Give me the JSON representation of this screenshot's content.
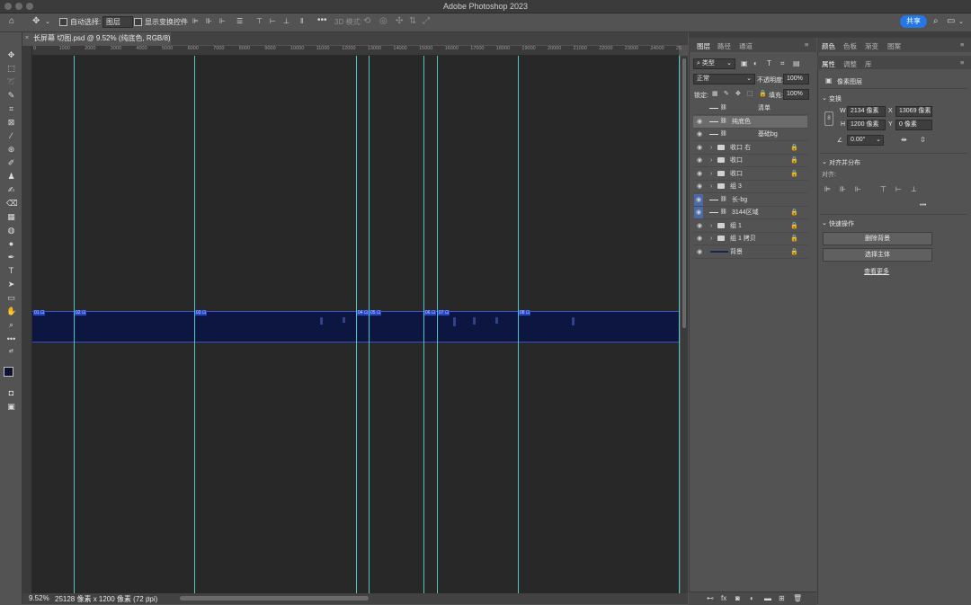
{
  "window": {
    "title": "Adobe Photoshop 2023"
  },
  "options_bar": {
    "auto_select_label": "自动选择:",
    "auto_select_value": "图层",
    "show_transform_label": "显示变换控件",
    "mode_3d_label": "3D 模式:",
    "share_label": "共享"
  },
  "document": {
    "tab_label": "长屏幕 切图.psd @ 9.52% (纯底色, RGB/8) *",
    "zoom": "9.52%",
    "info": "25128 像素 x 1200 像素 (72 ppi)"
  },
  "ruler": {
    "ticks": [
      "0",
      "1000",
      "2000",
      "3000",
      "4000",
      "5000",
      "6000",
      "7000",
      "8000",
      "9000",
      "10000",
      "11000",
      "12000",
      "13000",
      "14000",
      "15000",
      "16000",
      "17000",
      "18000",
      "19000",
      "20000",
      "21000",
      "22000",
      "23000",
      "24000",
      "25"
    ]
  },
  "slices": [
    "01",
    "02",
    "03",
    "04",
    "05",
    "06",
    "07",
    "08"
  ],
  "layers_panel": {
    "tabs": [
      "图层",
      "路径",
      "通道"
    ],
    "filter_label": "类型",
    "blend_mode": "正常",
    "opacity_label": "不透明度:",
    "opacity_value": "100%",
    "lock_label": "锁定:",
    "fill_label": "填充:",
    "fill_value": "100%",
    "layers": [
      {
        "name": "清单",
        "visible": false,
        "kind": "adjustment",
        "locked": false
      },
      {
        "name": "纯底色",
        "visible": true,
        "kind": "adjustment",
        "locked": false,
        "selected": true
      },
      {
        "name": "基础bg",
        "visible": true,
        "kind": "adjustment",
        "locked": false
      },
      {
        "name": "收口 右",
        "visible": true,
        "kind": "group",
        "locked": true
      },
      {
        "name": "收口",
        "visible": true,
        "kind": "group",
        "locked": true
      },
      {
        "name": "收口",
        "visible": true,
        "kind": "group",
        "locked": true
      },
      {
        "name": "组 3",
        "visible": true,
        "kind": "group",
        "locked": false
      },
      {
        "name": "长-bg",
        "visible": true,
        "kind": "adjustment",
        "locked": false
      },
      {
        "name": "3144区域",
        "visible": true,
        "kind": "adjustment",
        "locked": true
      },
      {
        "name": "组 1",
        "visible": true,
        "kind": "group",
        "locked": true
      },
      {
        "name": "组 1 拷贝",
        "visible": true,
        "kind": "group",
        "locked": true
      },
      {
        "name": "背景",
        "visible": true,
        "kind": "background",
        "locked": true
      }
    ]
  },
  "right_panel": {
    "top_tabs": [
      "颜色",
      "色板",
      "渐变",
      "图案"
    ],
    "sub_tabs": [
      "属性",
      "调整",
      "库"
    ],
    "pixel_layer_label": "像素图层",
    "transform_title": "变换",
    "w_label": "W",
    "w_value": "2134 像素",
    "h_label": "H",
    "h_value": "1200 像素",
    "x_label": "X",
    "x_value": "13069 像素",
    "y_label": "Y",
    "y_value": "0 像素",
    "angle_value": "0.00°",
    "align_title": "对齐并分布",
    "align_label": "对齐:",
    "quick_title": "快速操作",
    "remove_bg": "删除背景",
    "select_subject": "选择主体",
    "view_more": "查看更多"
  },
  "colors": {
    "accent": "#2477e4",
    "guide": "#4fc3c7",
    "band": "#0c1640",
    "foreground": "#0d1233"
  }
}
